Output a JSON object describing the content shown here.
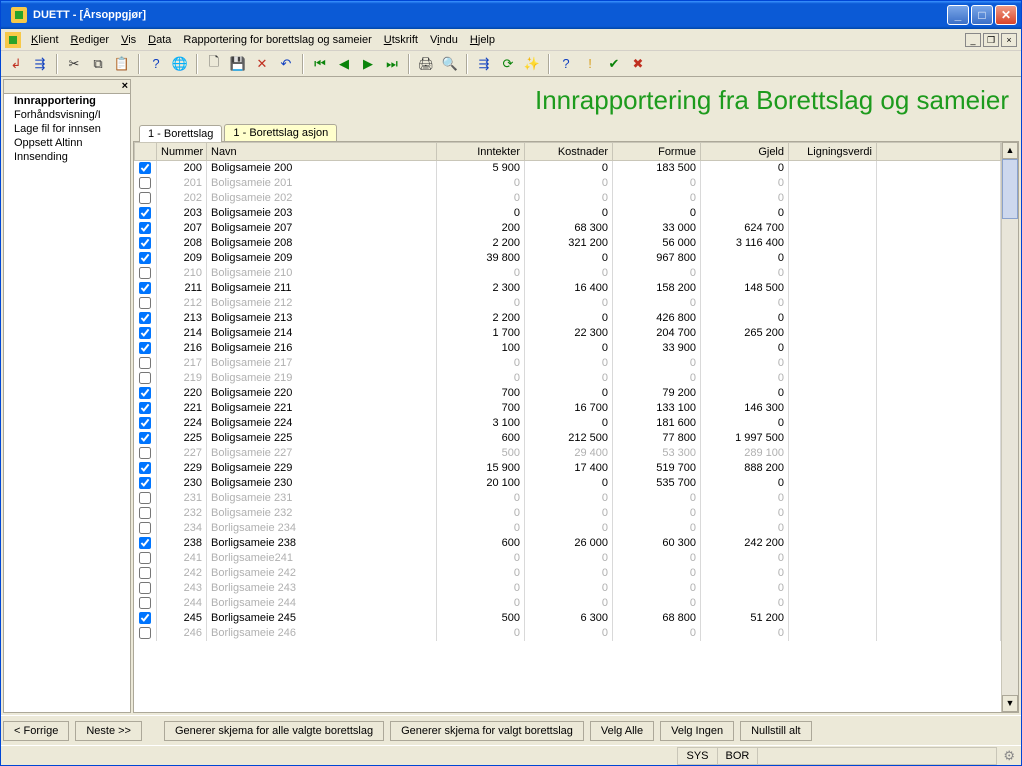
{
  "window": {
    "title": "DUETT - [Årsoppgjør]"
  },
  "menu": {
    "items": [
      "Klient",
      "Rediger",
      "Vis",
      "Data",
      "Rapportering for borettslag og sameier",
      "Utskrift",
      "Vindu",
      "Hjelp"
    ],
    "underline": [
      0,
      0,
      0,
      0,
      0,
      0,
      1,
      0
    ]
  },
  "sidebar": {
    "items": [
      {
        "label": "Innrapportering",
        "bold": true
      },
      {
        "label": "Forhåndsvisning/I",
        "bold": false
      },
      {
        "label": "Lage fil for innsen",
        "bold": false
      },
      {
        "label": "Oppsett Altinn",
        "bold": false
      },
      {
        "label": "Innsending",
        "bold": false
      }
    ]
  },
  "header": {
    "title": "Innrapportering fra Borettslag og sameier"
  },
  "tabs": [
    {
      "label": "1 - Borettslag",
      "active": true,
      "highlight": false
    },
    {
      "label": "1 - Borettslag asjon",
      "active": false,
      "highlight": true
    }
  ],
  "columns": [
    "",
    "Nummer",
    "Navn",
    "Inntekter",
    "Kostnader",
    "Formue",
    "Gjeld",
    "Ligningsverdi"
  ],
  "rows": [
    {
      "on": true,
      "num": "200",
      "name": "Boligsameie 200",
      "inntekter": "5 900",
      "kostnader": "0",
      "formue": "183 500",
      "gjeld": "0",
      "lign": ""
    },
    {
      "on": false,
      "num": "201",
      "name": "Boligsameie 201",
      "inntekter": "0",
      "kostnader": "0",
      "formue": "0",
      "gjeld": "0",
      "lign": ""
    },
    {
      "on": false,
      "num": "202",
      "name": "Boligsameie 202",
      "inntekter": "0",
      "kostnader": "0",
      "formue": "0",
      "gjeld": "0",
      "lign": ""
    },
    {
      "on": true,
      "num": "203",
      "name": "Boligsameie 203",
      "inntekter": "0",
      "kostnader": "0",
      "formue": "0",
      "gjeld": "0",
      "lign": ""
    },
    {
      "on": true,
      "num": "207",
      "name": "Boligsameie 207",
      "inntekter": "200",
      "kostnader": "68 300",
      "formue": "33 000",
      "gjeld": "624 700",
      "lign": ""
    },
    {
      "on": true,
      "num": "208",
      "name": "Boligsameie 208",
      "inntekter": "2 200",
      "kostnader": "321 200",
      "formue": "56 000",
      "gjeld": "3 116 400",
      "lign": ""
    },
    {
      "on": true,
      "num": "209",
      "name": "Boligsameie 209",
      "inntekter": "39 800",
      "kostnader": "0",
      "formue": "967 800",
      "gjeld": "0",
      "lign": ""
    },
    {
      "on": false,
      "num": "210",
      "name": "Boligsameie 210",
      "inntekter": "0",
      "kostnader": "0",
      "formue": "0",
      "gjeld": "0",
      "lign": ""
    },
    {
      "on": true,
      "num": "211",
      "name": "Boligsameie 211",
      "inntekter": "2 300",
      "kostnader": "16 400",
      "formue": "158 200",
      "gjeld": "148 500",
      "lign": ""
    },
    {
      "on": false,
      "num": "212",
      "name": "Boligsameie 212",
      "inntekter": "0",
      "kostnader": "0",
      "formue": "0",
      "gjeld": "0",
      "lign": ""
    },
    {
      "on": true,
      "num": "213",
      "name": "Boligsameie 213",
      "inntekter": "2 200",
      "kostnader": "0",
      "formue": "426 800",
      "gjeld": "0",
      "lign": ""
    },
    {
      "on": true,
      "num": "214",
      "name": "Boligsameie 214",
      "inntekter": "1 700",
      "kostnader": "22 300",
      "formue": "204 700",
      "gjeld": "265 200",
      "lign": ""
    },
    {
      "on": true,
      "num": "216",
      "name": "Boligsameie 216",
      "inntekter": "100",
      "kostnader": "0",
      "formue": "33 900",
      "gjeld": "0",
      "lign": ""
    },
    {
      "on": false,
      "num": "217",
      "name": "Boligsameie 217",
      "inntekter": "0",
      "kostnader": "0",
      "formue": "0",
      "gjeld": "0",
      "lign": ""
    },
    {
      "on": false,
      "num": "219",
      "name": "Boligsameie 219",
      "inntekter": "0",
      "kostnader": "0",
      "formue": "0",
      "gjeld": "0",
      "lign": ""
    },
    {
      "on": true,
      "num": "220",
      "name": "Boligsameie 220",
      "inntekter": "700",
      "kostnader": "0",
      "formue": "79 200",
      "gjeld": "0",
      "lign": ""
    },
    {
      "on": true,
      "num": "221",
      "name": "Boligsameie 221",
      "inntekter": "700",
      "kostnader": "16 700",
      "formue": "133 100",
      "gjeld": "146 300",
      "lign": ""
    },
    {
      "on": true,
      "num": "224",
      "name": "Boligsameie 224",
      "inntekter": "3 100",
      "kostnader": "0",
      "formue": "181 600",
      "gjeld": "0",
      "lign": ""
    },
    {
      "on": true,
      "num": "225",
      "name": "Boligsameie 225",
      "inntekter": "600",
      "kostnader": "212 500",
      "formue": "77 800",
      "gjeld": "1 997 500",
      "lign": ""
    },
    {
      "on": false,
      "num": "227",
      "name": "Boligsameie 227",
      "inntekter": "500",
      "kostnader": "29 400",
      "formue": "53 300",
      "gjeld": "289 100",
      "lign": ""
    },
    {
      "on": true,
      "num": "229",
      "name": "Boligsameie 229",
      "inntekter": "15 900",
      "kostnader": "17 400",
      "formue": "519 700",
      "gjeld": "888 200",
      "lign": ""
    },
    {
      "on": true,
      "num": "230",
      "name": "Boligsameie 230",
      "inntekter": "20 100",
      "kostnader": "0",
      "formue": "535 700",
      "gjeld": "0",
      "lign": ""
    },
    {
      "on": false,
      "num": "231",
      "name": "Boligsameie 231",
      "inntekter": "0",
      "kostnader": "0",
      "formue": "0",
      "gjeld": "0",
      "lign": ""
    },
    {
      "on": false,
      "num": "232",
      "name": "Boligsameie 232",
      "inntekter": "0",
      "kostnader": "0",
      "formue": "0",
      "gjeld": "0",
      "lign": ""
    },
    {
      "on": false,
      "num": "234",
      "name": "Borligsameie 234",
      "inntekter": "0",
      "kostnader": "0",
      "formue": "0",
      "gjeld": "0",
      "lign": ""
    },
    {
      "on": true,
      "num": "238",
      "name": "Borligsameie 238",
      "inntekter": "600",
      "kostnader": "26 000",
      "formue": "60 300",
      "gjeld": "242 200",
      "lign": ""
    },
    {
      "on": false,
      "num": "241",
      "name": "Borligsameie241",
      "inntekter": "0",
      "kostnader": "0",
      "formue": "0",
      "gjeld": "0",
      "lign": ""
    },
    {
      "on": false,
      "num": "242",
      "name": "Borligsameie 242",
      "inntekter": "0",
      "kostnader": "0",
      "formue": "0",
      "gjeld": "0",
      "lign": ""
    },
    {
      "on": false,
      "num": "243",
      "name": "Borligsameie 243",
      "inntekter": "0",
      "kostnader": "0",
      "formue": "0",
      "gjeld": "0",
      "lign": ""
    },
    {
      "on": false,
      "num": "244",
      "name": "Borligsameie 244",
      "inntekter": "0",
      "kostnader": "0",
      "formue": "0",
      "gjeld": "0",
      "lign": ""
    },
    {
      "on": true,
      "num": "245",
      "name": "Borligsameie 245",
      "inntekter": "500",
      "kostnader": "6 300",
      "formue": "68 800",
      "gjeld": "51 200",
      "lign": ""
    },
    {
      "on": false,
      "num": "246",
      "name": "Borligsameie 246",
      "inntekter": "0",
      "kostnader": "0",
      "formue": "0",
      "gjeld": "0",
      "lign": ""
    }
  ],
  "buttons": {
    "prev": "Forrige",
    "next": "Neste  >>",
    "gen_all": "Generer skjema for alle valgte borettslag",
    "gen_sel": "Generer skjema for valgt borettslag",
    "sel_all": "Velg Alle",
    "sel_none": "Velg Ingen",
    "reset": "Nullstill alt"
  },
  "status": {
    "sys": "SYS",
    "bor": "BOR"
  }
}
